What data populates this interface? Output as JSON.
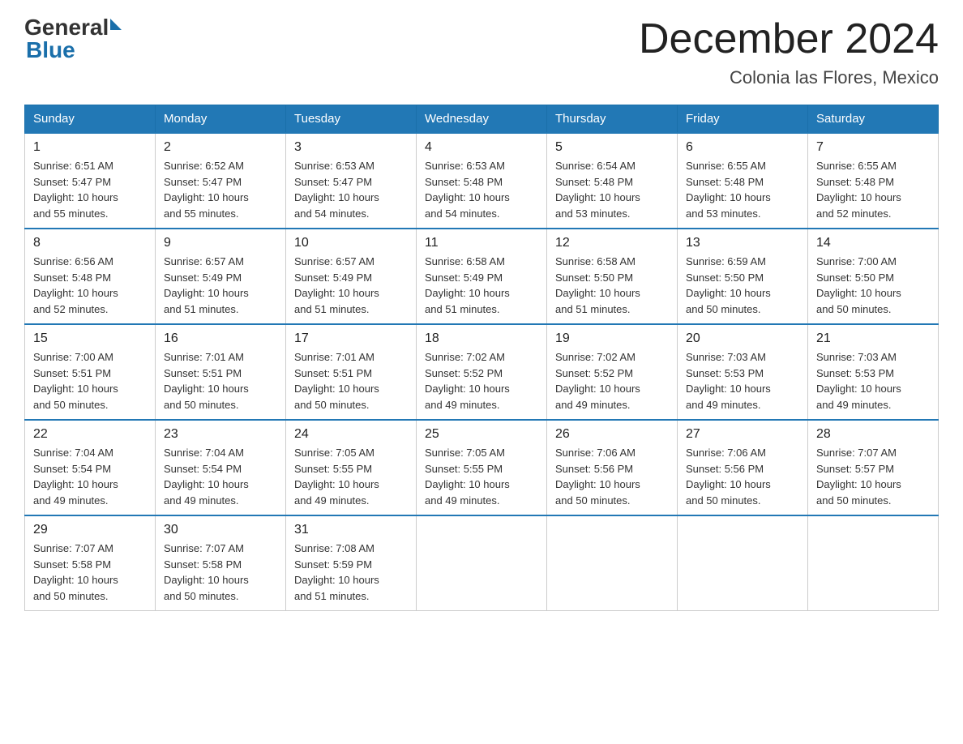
{
  "logo": {
    "general": "General",
    "blue": "Blue"
  },
  "title": "December 2024",
  "subtitle": "Colonia las Flores, Mexico",
  "weekdays": [
    "Sunday",
    "Monday",
    "Tuesday",
    "Wednesday",
    "Thursday",
    "Friday",
    "Saturday"
  ],
  "weeks": [
    [
      {
        "day": "1",
        "sunrise": "6:51 AM",
        "sunset": "5:47 PM",
        "daylight": "10 hours and 55 minutes."
      },
      {
        "day": "2",
        "sunrise": "6:52 AM",
        "sunset": "5:47 PM",
        "daylight": "10 hours and 55 minutes."
      },
      {
        "day": "3",
        "sunrise": "6:53 AM",
        "sunset": "5:47 PM",
        "daylight": "10 hours and 54 minutes."
      },
      {
        "day": "4",
        "sunrise": "6:53 AM",
        "sunset": "5:48 PM",
        "daylight": "10 hours and 54 minutes."
      },
      {
        "day": "5",
        "sunrise": "6:54 AM",
        "sunset": "5:48 PM",
        "daylight": "10 hours and 53 minutes."
      },
      {
        "day": "6",
        "sunrise": "6:55 AM",
        "sunset": "5:48 PM",
        "daylight": "10 hours and 53 minutes."
      },
      {
        "day": "7",
        "sunrise": "6:55 AM",
        "sunset": "5:48 PM",
        "daylight": "10 hours and 52 minutes."
      }
    ],
    [
      {
        "day": "8",
        "sunrise": "6:56 AM",
        "sunset": "5:48 PM",
        "daylight": "10 hours and 52 minutes."
      },
      {
        "day": "9",
        "sunrise": "6:57 AM",
        "sunset": "5:49 PM",
        "daylight": "10 hours and 51 minutes."
      },
      {
        "day": "10",
        "sunrise": "6:57 AM",
        "sunset": "5:49 PM",
        "daylight": "10 hours and 51 minutes."
      },
      {
        "day": "11",
        "sunrise": "6:58 AM",
        "sunset": "5:49 PM",
        "daylight": "10 hours and 51 minutes."
      },
      {
        "day": "12",
        "sunrise": "6:58 AM",
        "sunset": "5:50 PM",
        "daylight": "10 hours and 51 minutes."
      },
      {
        "day": "13",
        "sunrise": "6:59 AM",
        "sunset": "5:50 PM",
        "daylight": "10 hours and 50 minutes."
      },
      {
        "day": "14",
        "sunrise": "7:00 AM",
        "sunset": "5:50 PM",
        "daylight": "10 hours and 50 minutes."
      }
    ],
    [
      {
        "day": "15",
        "sunrise": "7:00 AM",
        "sunset": "5:51 PM",
        "daylight": "10 hours and 50 minutes."
      },
      {
        "day": "16",
        "sunrise": "7:01 AM",
        "sunset": "5:51 PM",
        "daylight": "10 hours and 50 minutes."
      },
      {
        "day": "17",
        "sunrise": "7:01 AM",
        "sunset": "5:51 PM",
        "daylight": "10 hours and 50 minutes."
      },
      {
        "day": "18",
        "sunrise": "7:02 AM",
        "sunset": "5:52 PM",
        "daylight": "10 hours and 49 minutes."
      },
      {
        "day": "19",
        "sunrise": "7:02 AM",
        "sunset": "5:52 PM",
        "daylight": "10 hours and 49 minutes."
      },
      {
        "day": "20",
        "sunrise": "7:03 AM",
        "sunset": "5:53 PM",
        "daylight": "10 hours and 49 minutes."
      },
      {
        "day": "21",
        "sunrise": "7:03 AM",
        "sunset": "5:53 PM",
        "daylight": "10 hours and 49 minutes."
      }
    ],
    [
      {
        "day": "22",
        "sunrise": "7:04 AM",
        "sunset": "5:54 PM",
        "daylight": "10 hours and 49 minutes."
      },
      {
        "day": "23",
        "sunrise": "7:04 AM",
        "sunset": "5:54 PM",
        "daylight": "10 hours and 49 minutes."
      },
      {
        "day": "24",
        "sunrise": "7:05 AM",
        "sunset": "5:55 PM",
        "daylight": "10 hours and 49 minutes."
      },
      {
        "day": "25",
        "sunrise": "7:05 AM",
        "sunset": "5:55 PM",
        "daylight": "10 hours and 49 minutes."
      },
      {
        "day": "26",
        "sunrise": "7:06 AM",
        "sunset": "5:56 PM",
        "daylight": "10 hours and 50 minutes."
      },
      {
        "day": "27",
        "sunrise": "7:06 AM",
        "sunset": "5:56 PM",
        "daylight": "10 hours and 50 minutes."
      },
      {
        "day": "28",
        "sunrise": "7:07 AM",
        "sunset": "5:57 PM",
        "daylight": "10 hours and 50 minutes."
      }
    ],
    [
      {
        "day": "29",
        "sunrise": "7:07 AM",
        "sunset": "5:58 PM",
        "daylight": "10 hours and 50 minutes."
      },
      {
        "day": "30",
        "sunrise": "7:07 AM",
        "sunset": "5:58 PM",
        "daylight": "10 hours and 50 minutes."
      },
      {
        "day": "31",
        "sunrise": "7:08 AM",
        "sunset": "5:59 PM",
        "daylight": "10 hours and 51 minutes."
      },
      null,
      null,
      null,
      null
    ]
  ],
  "labels": {
    "sunrise": "Sunrise:",
    "sunset": "Sunset:",
    "daylight": "Daylight:"
  }
}
